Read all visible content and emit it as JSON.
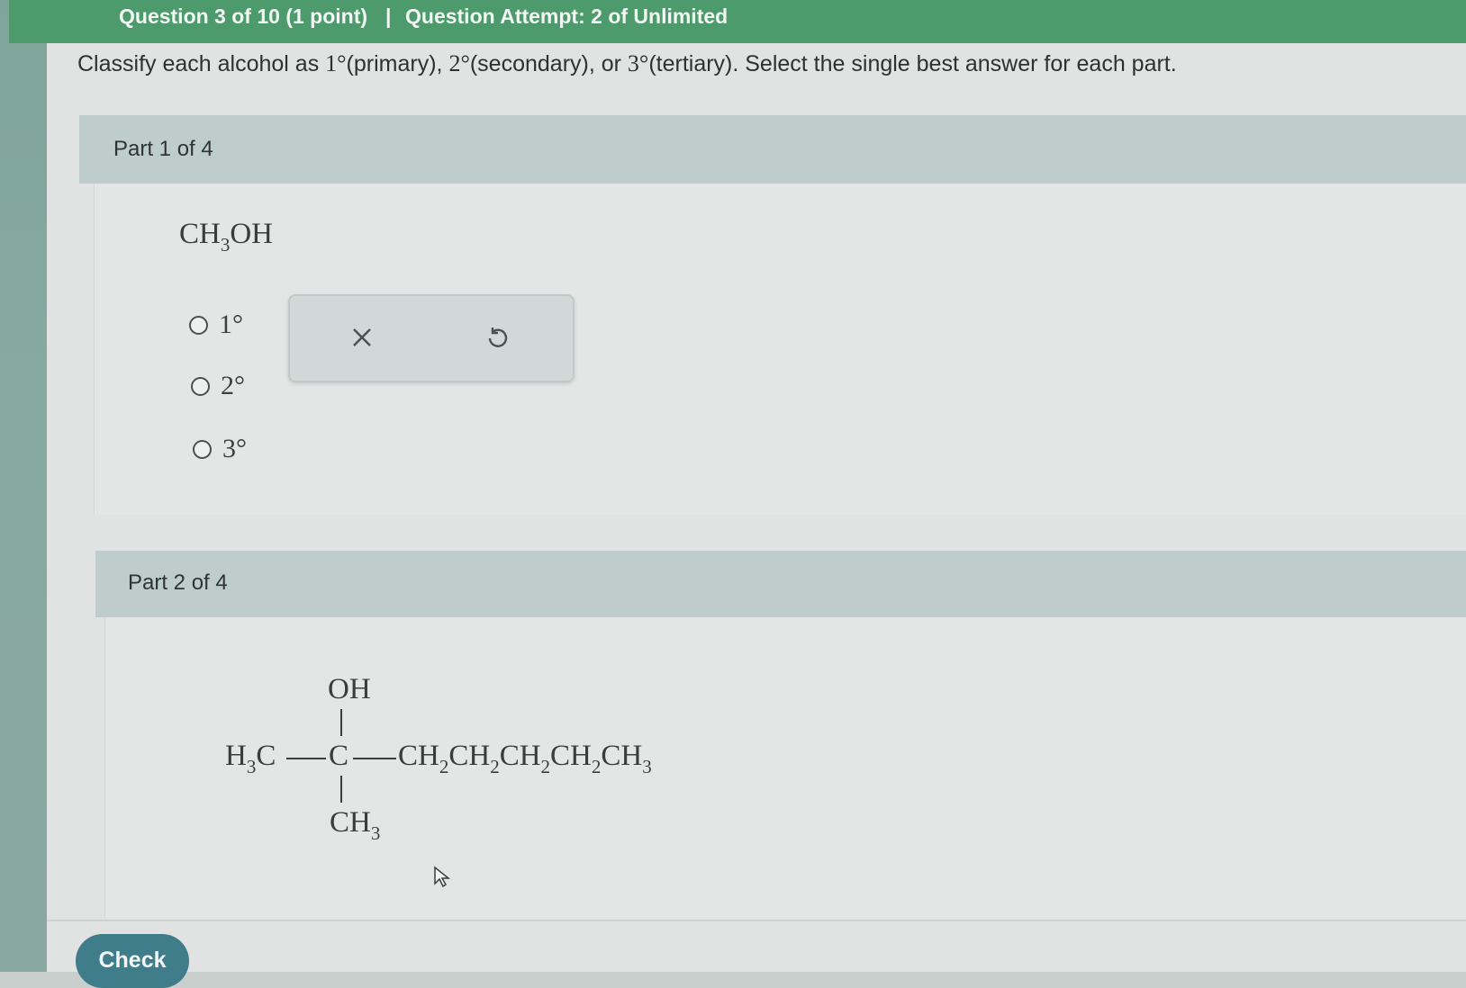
{
  "header": {
    "question_label": "Question 3 of 10 (1 point)",
    "separator": "|",
    "attempt_label": "Question Attempt: 2 of Unlimited"
  },
  "instructions": {
    "p1": "Classify each alcohol as ",
    "deg1": "1°",
    "p2": "(primary), ",
    "deg2": "2°",
    "p3": "(secondary), or ",
    "deg3": "3°",
    "p4": "(tertiary). Select the single best answer for each part."
  },
  "part1": {
    "title": "Part 1 of 4",
    "formula": {
      "base": "CH",
      "sub": "3",
      "rest": "OH"
    },
    "options": [
      "1°",
      "2°",
      "3°"
    ],
    "tools": {
      "clear_icon": "close-icon",
      "reset_icon": "undo-icon"
    }
  },
  "part2": {
    "title": "Part 2 of 4",
    "structure": {
      "top": "OH",
      "left_main": "H",
      "left_sub": "3",
      "left_tail": "C",
      "center": "C",
      "chain": [
        {
          "t": "CH",
          "s": "2"
        },
        {
          "t": "CH",
          "s": "2"
        },
        {
          "t": "CH",
          "s": "2"
        },
        {
          "t": "CH",
          "s": "2"
        },
        {
          "t": "CH",
          "s": "3"
        }
      ],
      "bottom_main": "CH",
      "bottom_sub": "3"
    }
  },
  "footer": {
    "check_label": "Check"
  }
}
